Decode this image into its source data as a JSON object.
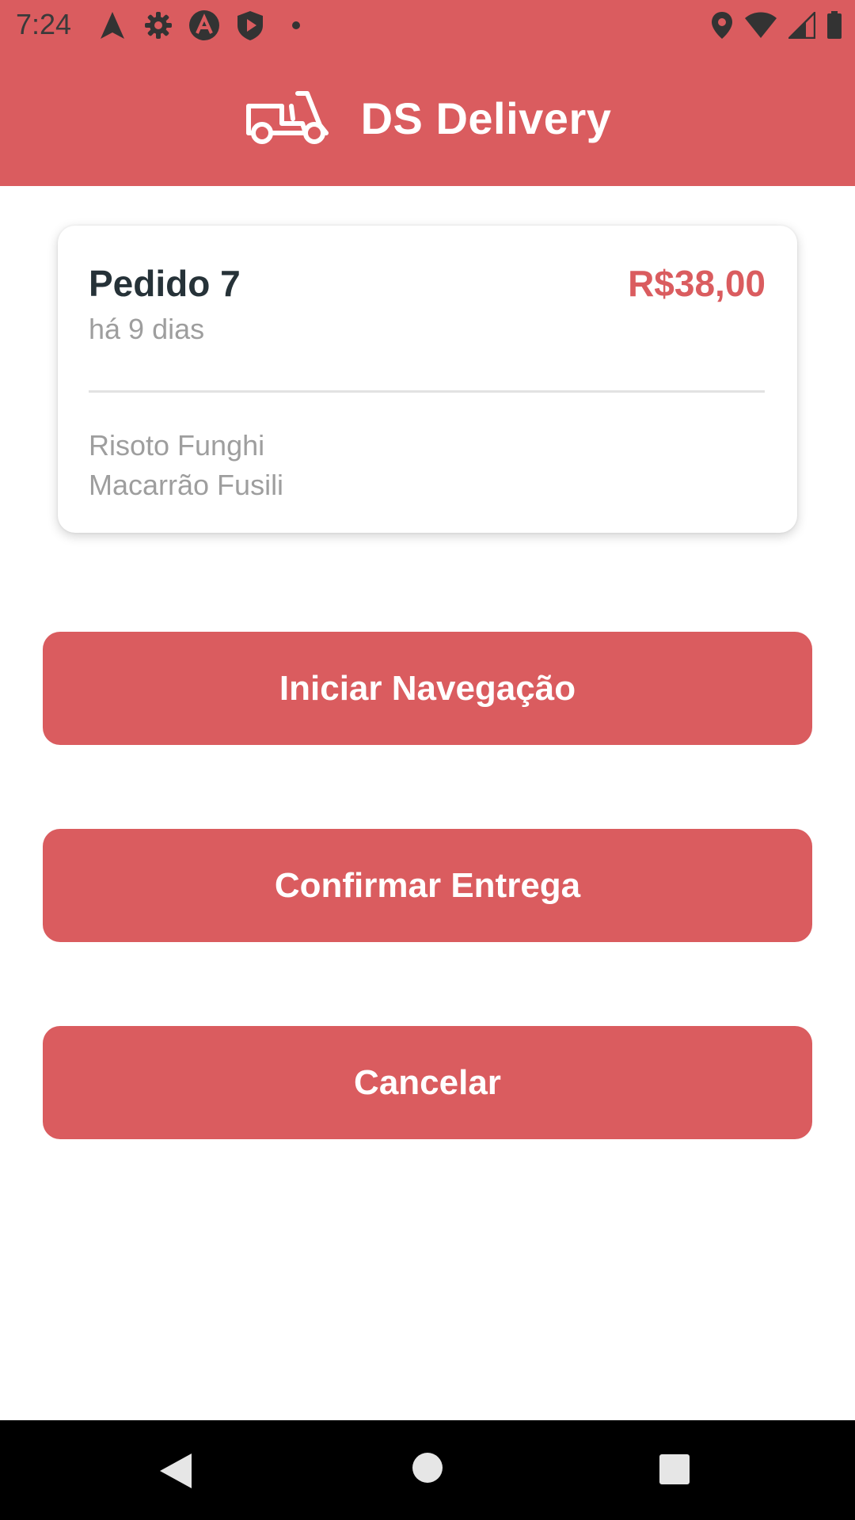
{
  "status_bar": {
    "time": "7:24",
    "icons_left": [
      "navigation-icon",
      "settings-icon",
      "app-a-icon",
      "shield-play-icon",
      "dot-icon"
    ],
    "icons_right": [
      "location-icon",
      "wifi-icon",
      "signal-icon",
      "battery-icon"
    ]
  },
  "header": {
    "title": "DS Delivery",
    "logo": "scooter-icon"
  },
  "order": {
    "name": "Pedido 7",
    "price": "R$38,00",
    "time": "há 9 dias",
    "items": [
      "Risoto Funghi",
      "Macarrão Fusili"
    ]
  },
  "buttons": {
    "navigate": "Iniciar Navegação",
    "confirm": "Confirmar Entrega",
    "cancel": "Cancelar"
  },
  "nav_bar": {
    "icons": [
      "back-icon",
      "home-icon",
      "recents-icon"
    ]
  },
  "colors": {
    "primary": "#DA5C5F",
    "text_dark": "#263238",
    "text_muted": "#9E9E9E"
  }
}
